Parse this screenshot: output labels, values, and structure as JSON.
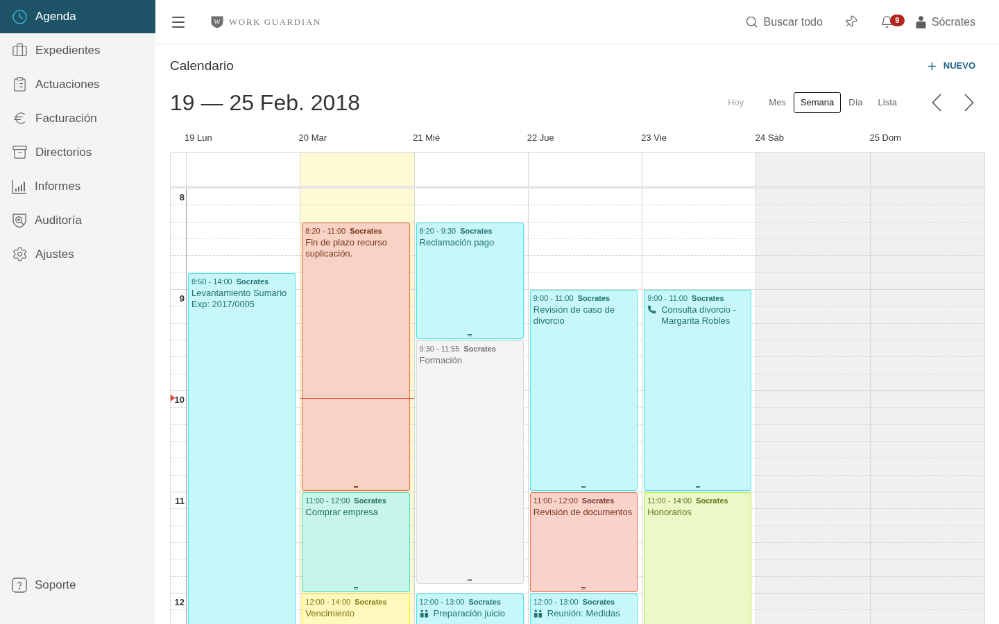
{
  "sidebar": {
    "items": [
      {
        "label": "Agenda",
        "selected": true
      },
      {
        "label": "Expedientes",
        "selected": false
      },
      {
        "label": "Actuaciones",
        "selected": false
      },
      {
        "label": "Facturación",
        "selected": false
      },
      {
        "label": "Directorios",
        "selected": false
      },
      {
        "label": "Informes",
        "selected": false
      },
      {
        "label": "Auditoría",
        "selected": false
      },
      {
        "label": "Ajustes",
        "selected": false
      }
    ],
    "support": {
      "label": "Soporte"
    }
  },
  "header": {
    "logo_mark": "W",
    "brand": "WORK GUARDIAN",
    "search": {
      "label": "Buscar todo"
    },
    "notifications": {
      "count": "9"
    },
    "user": {
      "name": "Sócrates"
    }
  },
  "calendar": {
    "title": "Calendario",
    "new_button": "NUEVO",
    "range": "19 — 25 Feb. 2018",
    "views": [
      {
        "label": "Hoy",
        "selected": false,
        "disabled": true
      },
      {
        "label": "Mes",
        "selected": false,
        "disabled": false
      },
      {
        "label": "Semana",
        "selected": true,
        "disabled": false
      },
      {
        "label": "Día",
        "selected": false,
        "disabled": false
      },
      {
        "label": "Lista",
        "selected": false,
        "disabled": false
      }
    ],
    "hours": [
      "8",
      "9",
      "10",
      "11",
      "12"
    ],
    "days": [
      {
        "label": "19 Lun",
        "today": false,
        "weekend": false,
        "events": [
          {
            "kind": "task",
            "time": "8:50 - 14:00",
            "owner": "Socrates",
            "title": "Levantamiento Sumario",
            "case": "Exp: 2017/0005",
            "color": "#44e4eb"
          }
        ]
      },
      {
        "label": "20 Mar",
        "today": true,
        "weekend": false,
        "events": [
          {
            "kind": "task",
            "time": "8:20 - 11:00",
            "owner": "Socrates",
            "title": "Fin de plazo recurso suplicación.",
            "color": "#e86a3a"
          },
          {
            "kind": "task",
            "time": "11:00 - 12:00",
            "owner": "Socrates",
            "title": "Comprar empresa",
            "color": "#48deb9"
          },
          {
            "kind": "task",
            "time": "12:00 - 14:00",
            "owner": "Socrates",
            "title": "Vencimiento",
            "color": "#ffeb23"
          }
        ]
      },
      {
        "label": "21 Mié",
        "today": false,
        "weekend": false,
        "events": [
          {
            "kind": "task",
            "time": "8:20 - 9:30",
            "owner": "Socrates",
            "title": "Reclamación pago",
            "color": "#44e4eb"
          },
          {
            "kind": "task",
            "time": "9:30 - 11:55",
            "owner": "Socrates",
            "title": "Formación",
            "color": "#d9d9d9"
          },
          {
            "kind": "meeting",
            "time": "12:00 - 13:00",
            "owner": "Socrates",
            "title": "Preparación juicio",
            "color": "#44e4eb"
          }
        ]
      },
      {
        "label": "22 Jue",
        "today": false,
        "weekend": false,
        "events": [
          {
            "kind": "task",
            "time": "9:00 - 11:00",
            "owner": "Socrates",
            "title": "Revisión de caso de divorcio",
            "color": "#44e4eb"
          },
          {
            "kind": "task",
            "time": "11:00 - 12:00",
            "owner": "Socrates",
            "title": "Revisión de documentos",
            "color": "#ec6d4b"
          },
          {
            "kind": "meeting",
            "time": "12:00 - 13:00",
            "owner": "Socrates",
            "title": "Reunión: Medidas",
            "color": "#44e4eb"
          }
        ]
      },
      {
        "label": "23 Vie",
        "today": false,
        "weekend": false,
        "events": [
          {
            "kind": "call",
            "time": "9:00 - 11:00",
            "owner": "Socrates",
            "title": "Consulta divorcio - Margarita Robles",
            "color": "#44e4eb"
          },
          {
            "kind": "task",
            "time": "11:00 - 14:00",
            "owner": "Socrates",
            "title": "Honorarios",
            "color": "#bceb41"
          }
        ]
      },
      {
        "label": "24 Sáb",
        "today": false,
        "weekend": true
      },
      {
        "label": "25 Dom",
        "today": false,
        "weekend": true
      }
    ]
  }
}
